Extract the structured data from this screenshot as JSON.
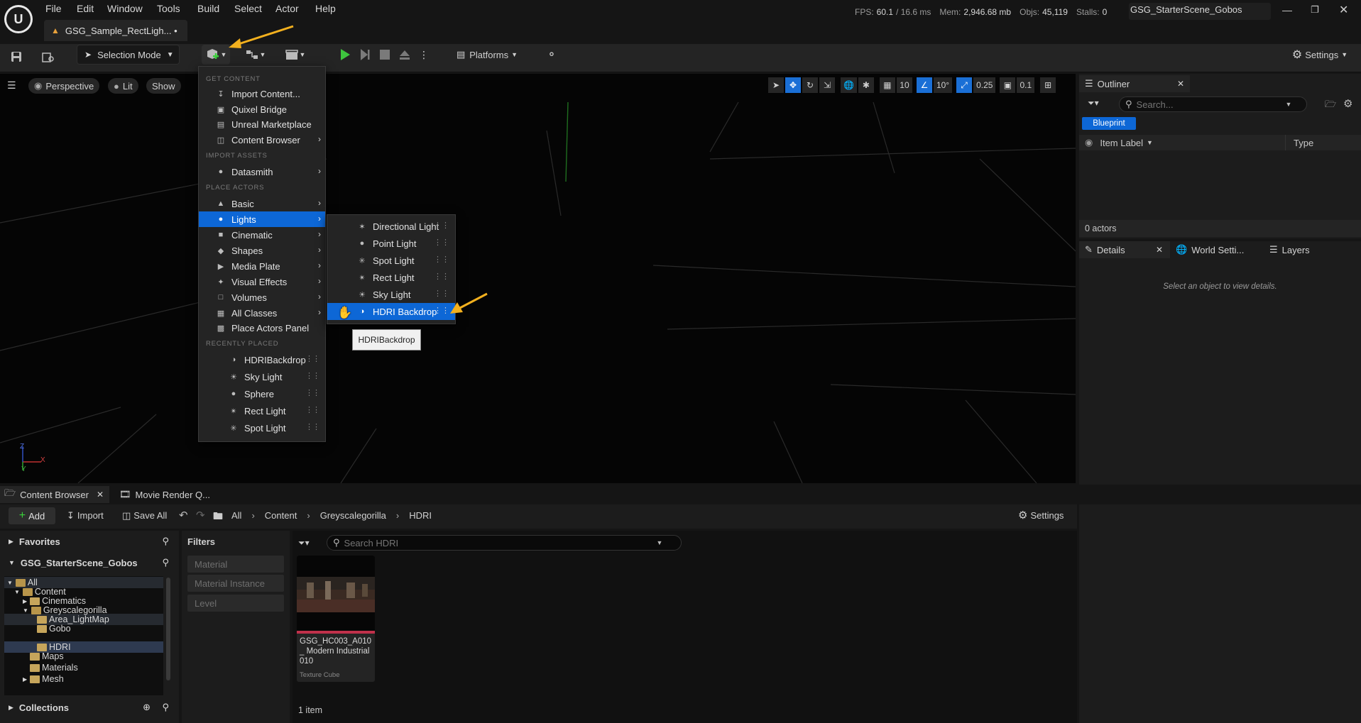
{
  "app": {
    "logo": "unreal-logo",
    "menu": [
      "File",
      "Edit",
      "Window",
      "Tools",
      "Build",
      "Select",
      "Actor",
      "Help"
    ],
    "stats": {
      "fps_label": "FPS:",
      "fps": "60.1",
      "ms": "/ 16.6 ms",
      "mem_label": "Mem:",
      "mem": "2,946.68 mb",
      "objs_label": "Objs:",
      "objs": "45,119",
      "stalls_label": "Stalls:",
      "stalls": "0"
    },
    "project_name": "GSG_StarterScene_Gobos",
    "level_tab": "GSG_Sample_RectLigh... •"
  },
  "toolbar": {
    "selection_mode": "Selection Mode",
    "platforms": "Platforms",
    "settings": "Settings"
  },
  "viewport": {
    "perspective": "Perspective",
    "lit": "Lit",
    "show": "Show",
    "grid_snap": "10",
    "rot_snap": "10°",
    "scale_snap": "0.25",
    "camera_speed": "0.1",
    "axis_x": "X",
    "axis_y": "Y",
    "axis_z": "Z"
  },
  "add_menu": {
    "headers": {
      "get_content": "GET CONTENT",
      "import_assets": "IMPORT ASSETS",
      "place_actors": "PLACE ACTORS",
      "recently_placed": "RECENTLY PLACED"
    },
    "get_content": [
      "Import Content...",
      "Quixel Bridge",
      "Unreal Marketplace",
      "Content Browser"
    ],
    "import_assets": [
      "Datasmith"
    ],
    "place_actors": [
      "Basic",
      "Lights",
      "Cinematic",
      "Shapes",
      "Media Plate",
      "Visual Effects",
      "Volumes",
      "All Classes",
      "Place Actors Panel"
    ],
    "recently_placed": [
      "HDRIBackdrop",
      "Sky Light",
      "Sphere",
      "Rect Light",
      "Spot Light"
    ]
  },
  "lights_submenu": [
    "Directional Light",
    "Point Light",
    "Spot Light",
    "Rect Light",
    "Sky Light",
    "HDRI Backdrop"
  ],
  "tooltip": "HDRIBackdrop",
  "outliner": {
    "title": "Outliner",
    "search_placeholder": "Search...",
    "blueprint_filter": "Blueprint",
    "col_label": "Item Label",
    "col_type": "Type",
    "count": "0 actors"
  },
  "details": {
    "tab_details": "Details",
    "tab_world": "World Setti...",
    "tab_layers": "Layers",
    "empty_msg": "Select an object to view details."
  },
  "content_browser": {
    "tab": "Content Browser",
    "tab2": "Movie Render Q...",
    "add": "Add",
    "import": "Import",
    "save_all": "Save All",
    "breadcrumb": [
      "All",
      "Content",
      "Greyscalegorilla",
      "HDRI"
    ],
    "settings": "Settings",
    "favorites": "Favorites",
    "project": "GSG_StarterScene_Gobos",
    "tree": [
      "All",
      "Content",
      "Cinematics",
      "Greyscalegorilla",
      "Area_LightMap",
      "Gobo",
      "HDRI",
      "Maps",
      "Materials",
      "Mesh"
    ],
    "collections": "Collections",
    "filters_title": "Filters",
    "filters": [
      "Material",
      "Material Instance",
      "Level"
    ],
    "search_placeholder": "Search HDRI",
    "asset_name": "GSG_HC003_A010_ Modern Industrial010",
    "asset_type": "Texture Cube",
    "item_count": "1 item"
  },
  "colors": {
    "accent": "#0d67d6",
    "annotation": "#f2b01e",
    "folder": "#c6a55b"
  }
}
